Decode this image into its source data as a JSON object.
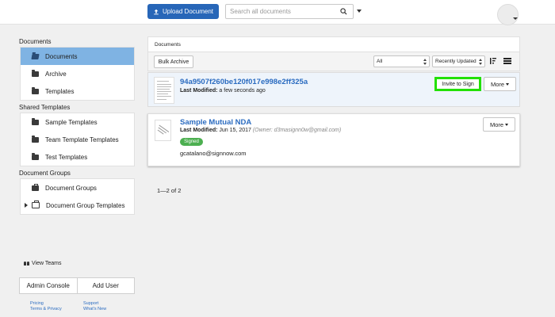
{
  "topbar": {
    "upload_label": "Upload Document",
    "search_placeholder": "Search all documents"
  },
  "sidebar": {
    "documents_title": "Documents",
    "documents_items": [
      {
        "label": "Documents",
        "icon": "folder-open-icon",
        "active": true
      },
      {
        "label": "Archive",
        "icon": "folder-icon"
      },
      {
        "label": "Templates",
        "icon": "folder-icon"
      }
    ],
    "shared_title": "Shared Templates",
    "shared_items": [
      {
        "label": "Sample Templates",
        "icon": "folder-icon"
      },
      {
        "label": "Team Template Templates",
        "icon": "folder-icon"
      },
      {
        "label": "Test Templates",
        "icon": "folder-icon"
      }
    ],
    "groups_title": "Document Groups",
    "groups_items": [
      {
        "label": "Document Groups",
        "icon": "briefcase-icon"
      },
      {
        "label": "Document Group Templates",
        "icon": "briefcase-outline-icon"
      }
    ],
    "view_teams": "View Teams",
    "admin_console": "Admin Console",
    "add_user": "Add User",
    "links": {
      "pricing": "Pricing",
      "terms": "Terms & Privacy",
      "support": "Support",
      "whats_new": "What's New"
    }
  },
  "main": {
    "header": "Documents",
    "bulk_archive": "Bulk Archive",
    "filter_value": "All",
    "sort_value": "Recently Updated",
    "documents": [
      {
        "title": "94a9507f260be120f017e998e2ff325a",
        "modified_label": "Last Modified:",
        "modified_value": "a few seconds ago",
        "invite_label": "Invite to Sign",
        "more_label": "More"
      },
      {
        "title": "Sample Mutual NDA",
        "modified_label": "Last Modified:",
        "modified_value": "Jun 15, 2017",
        "owner": "(Owner: d3masignn0w@gmail.com)",
        "status": "Signed",
        "signer": "gcatalano@signnow.com",
        "more_label": "More"
      }
    ],
    "pagination": "1—2 of 2"
  },
  "colors": {
    "accent": "#2766b8",
    "active_item": "#7fb3e3",
    "link": "#2a6bc0",
    "signed": "#4caf50",
    "highlight": "#22e000"
  }
}
